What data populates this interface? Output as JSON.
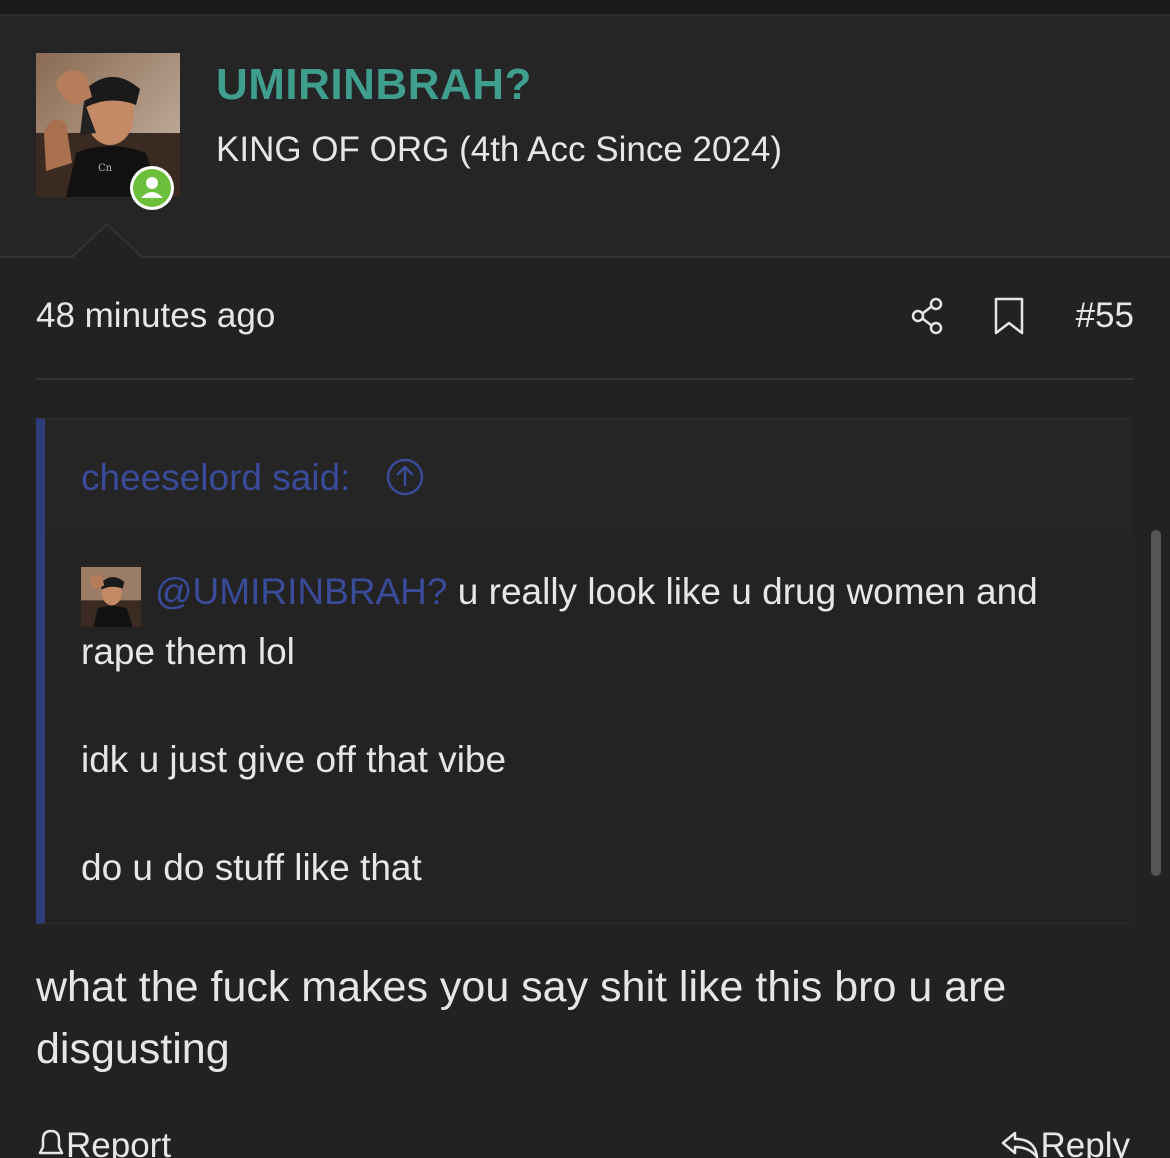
{
  "post": {
    "username": "UMIRINBRAH?",
    "user_title": "KING OF ORG (4th Acc Since 2024)",
    "time": "48 minutes ago",
    "post_number": "#55",
    "share_icon": "share-icon",
    "bookmark_icon": "bookmark-icon",
    "online_icon": "online-user-icon"
  },
  "quote": {
    "author": "cheeselord said:",
    "mention": "@UMIRINBRAH?",
    "line1_rest": " u really look like u drug women and",
    "line2": "rape them lol",
    "line3": "idk u just give off that vibe",
    "line4": "do u do stuff like that"
  },
  "reply_text": "what the fuck makes you say shit like this bro u are disgusting",
  "actions": {
    "report_label": "Report",
    "reply_label": "Reply"
  },
  "colors": {
    "background": "#222222",
    "username": "#3f9e8e",
    "quote_accent": "#2f3b7a",
    "mention": "#3a4b9a",
    "online": "#6cbf3a"
  }
}
